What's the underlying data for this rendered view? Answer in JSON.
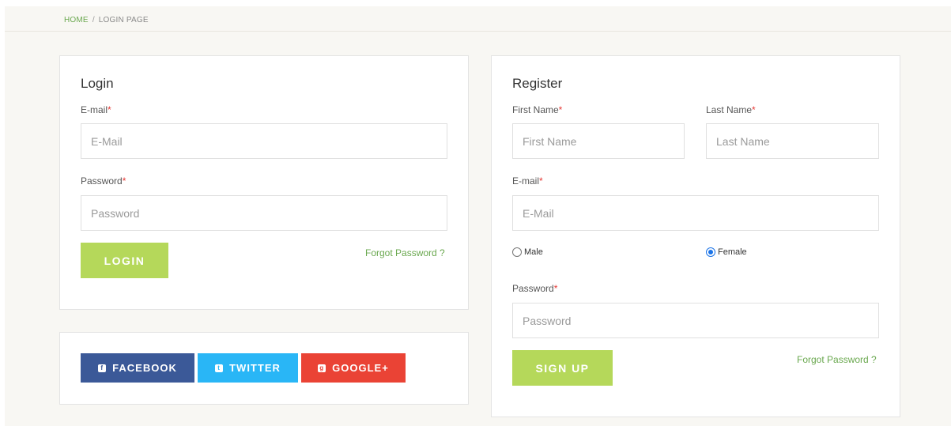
{
  "breadcrumb": {
    "home": "HOME",
    "separator": "/",
    "current": "LOGIN PAGE"
  },
  "login": {
    "title": "Login",
    "email_label": "E-mail",
    "email_placeholder": "E-Mail",
    "password_label": "Password",
    "password_placeholder": "Password",
    "required_mark": "*",
    "submit_label": "LOGIN",
    "forgot_link": "Forgot Password ?"
  },
  "social": {
    "facebook": {
      "label": "FACEBOOK",
      "color": "#3b5998",
      "icon": "facebook-icon",
      "glyph": "f"
    },
    "twitter": {
      "label": "TWITTER",
      "color": "#29b6f6",
      "icon": "twitter-icon",
      "glyph": "t"
    },
    "google": {
      "label": "GOOGLE+",
      "color": "#ea4335",
      "icon": "google-plus-icon",
      "glyph": "g"
    }
  },
  "register": {
    "title": "Register",
    "first_name_label": "First Name",
    "first_name_placeholder": "First Name",
    "last_name_label": "Last Name",
    "last_name_placeholder": "Last Name",
    "email_label": "E-mail",
    "email_placeholder": "E-Mail",
    "gender_options": [
      {
        "label": "Male",
        "selected": false
      },
      {
        "label": "Female",
        "selected": true
      }
    ],
    "password_label": "Password",
    "password_placeholder": "Password",
    "required_mark": "*",
    "submit_label": "SIGN UP",
    "forgot_link": "Forgot Password ?"
  },
  "colors": {
    "accent_green": "#b5d85a",
    "link_green": "#6aa84f",
    "required_red": "#e53935"
  }
}
